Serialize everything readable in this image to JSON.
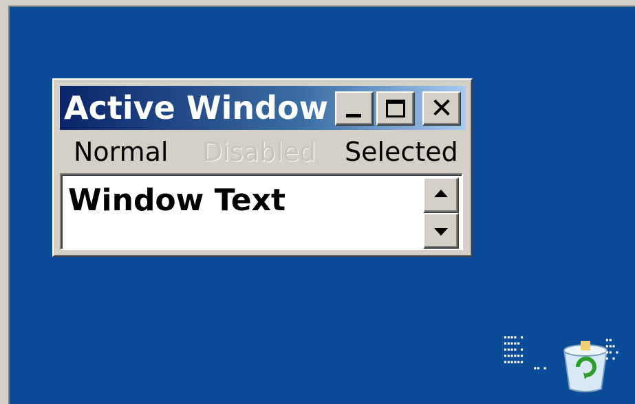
{
  "window": {
    "title": "Active Window",
    "buttons": {
      "minimize": "_",
      "maximize": "",
      "close": "✕"
    }
  },
  "menu": {
    "normal": "Normal",
    "disabled": "Disabled",
    "selected": "Selected"
  },
  "content": {
    "text": "Window Text"
  },
  "desktop": {
    "background": "#0a4c97",
    "icon": "recycle-bin-icon"
  },
  "colors": {
    "title_gradient_start": "#0a246a",
    "title_gradient_end": "#a6caf0",
    "window_face": "#d4d0c8"
  }
}
